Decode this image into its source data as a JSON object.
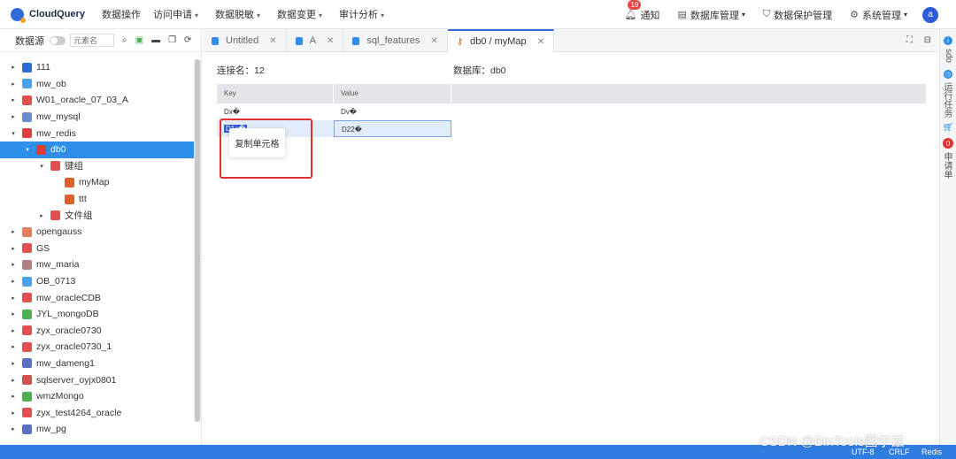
{
  "app": {
    "name": "CloudQuery"
  },
  "nav": {
    "items": [
      {
        "label": "数据操作",
        "chevron": false
      },
      {
        "label": "访问申请",
        "chevron": true
      },
      {
        "label": "数据脱敏",
        "chevron": true
      },
      {
        "label": "数据变更",
        "chevron": true
      },
      {
        "label": "审计分析",
        "chevron": true
      }
    ],
    "right": {
      "notify_badge": "19",
      "notify_label": "通知",
      "db_manage_label": "数据库管理",
      "protect_label": "数据保护管理",
      "system_label": "系统管理",
      "avatar_letter": "a"
    }
  },
  "sidebar": {
    "label": "数据源",
    "search_placeholder": "元素名",
    "tree": [
      {
        "label": "111",
        "expanded": false,
        "color": "#2f6bd8"
      },
      {
        "label": "mw_ob",
        "expanded": false,
        "color": "#4aa3e8"
      },
      {
        "label": "W01_oracle_07_03_A",
        "expanded": false,
        "color": "#e05050"
      },
      {
        "label": "mw_mysql",
        "expanded": false,
        "color": "#6a8cc8"
      },
      {
        "label": "mw_redis",
        "expanded": true,
        "color": "#d84040"
      },
      {
        "label": "db0",
        "expanded": true,
        "selected": true,
        "level": 1,
        "color": "#d84040"
      },
      {
        "label": "键组",
        "expanded": true,
        "level": 2,
        "color": "#e05050"
      },
      {
        "label": "myMap",
        "level": 3,
        "color": "#e06030"
      },
      {
        "label": "ttt",
        "level": 3,
        "color": "#e06030"
      },
      {
        "label": "文件组",
        "expanded": false,
        "level": 2,
        "color": "#e05050"
      },
      {
        "label": "opengauss",
        "expanded": false,
        "color": "#e08060"
      },
      {
        "label": "GS",
        "expanded": false,
        "color": "#e05050"
      },
      {
        "label": "mw_maria",
        "expanded": false,
        "color": "#b08080"
      },
      {
        "label": "OB_0713",
        "expanded": false,
        "color": "#4aa3e8"
      },
      {
        "label": "mw_oracleCDB",
        "expanded": false,
        "color": "#e05050"
      },
      {
        "label": "JYL_mongoDB",
        "expanded": false,
        "color": "#4caf50"
      },
      {
        "label": "zyx_oracle0730",
        "expanded": false,
        "color": "#e05050"
      },
      {
        "label": "zyx_oracle0730_1",
        "expanded": false,
        "color": "#e05050"
      },
      {
        "label": "mw_dameng1",
        "expanded": false,
        "color": "#5a70c0"
      },
      {
        "label": "sqlserver_oyjx0801",
        "expanded": false,
        "color": "#d05050"
      },
      {
        "label": "wmzMongo",
        "expanded": false,
        "color": "#4caf50"
      },
      {
        "label": "zyx_test4264_oracle",
        "expanded": false,
        "color": "#e05050"
      },
      {
        "label": "mw_pg",
        "expanded": false,
        "color": "#5a70c0"
      }
    ]
  },
  "tabs": [
    {
      "label": "Untitled",
      "active": false
    },
    {
      "label": "A",
      "active": false
    },
    {
      "label": "sql_features",
      "active": false
    },
    {
      "label": "db0 / myMap",
      "active": true
    }
  ],
  "rail": {
    "item1": "sdo",
    "item2": "运行任务",
    "badge": "0",
    "item3": "申请单"
  },
  "content": {
    "conn_label": "连接名：12",
    "db_label": "数据库：db0",
    "grid": {
      "headers": [
        "Key",
        "Value"
      ],
      "rows": [
        {
          "key": "Dx�",
          "value": "Dv�"
        },
        {
          "key": "D1x�",
          "value": "D22�"
        }
      ]
    },
    "context_menu": {
      "copy_cell": "复制单元格"
    }
  },
  "statusbar": {
    "encoding": "UTF-8",
    "line_ending": "CRLF",
    "db_type": "Redis"
  },
  "watermark": "CSDN @BinTools图尔兹"
}
